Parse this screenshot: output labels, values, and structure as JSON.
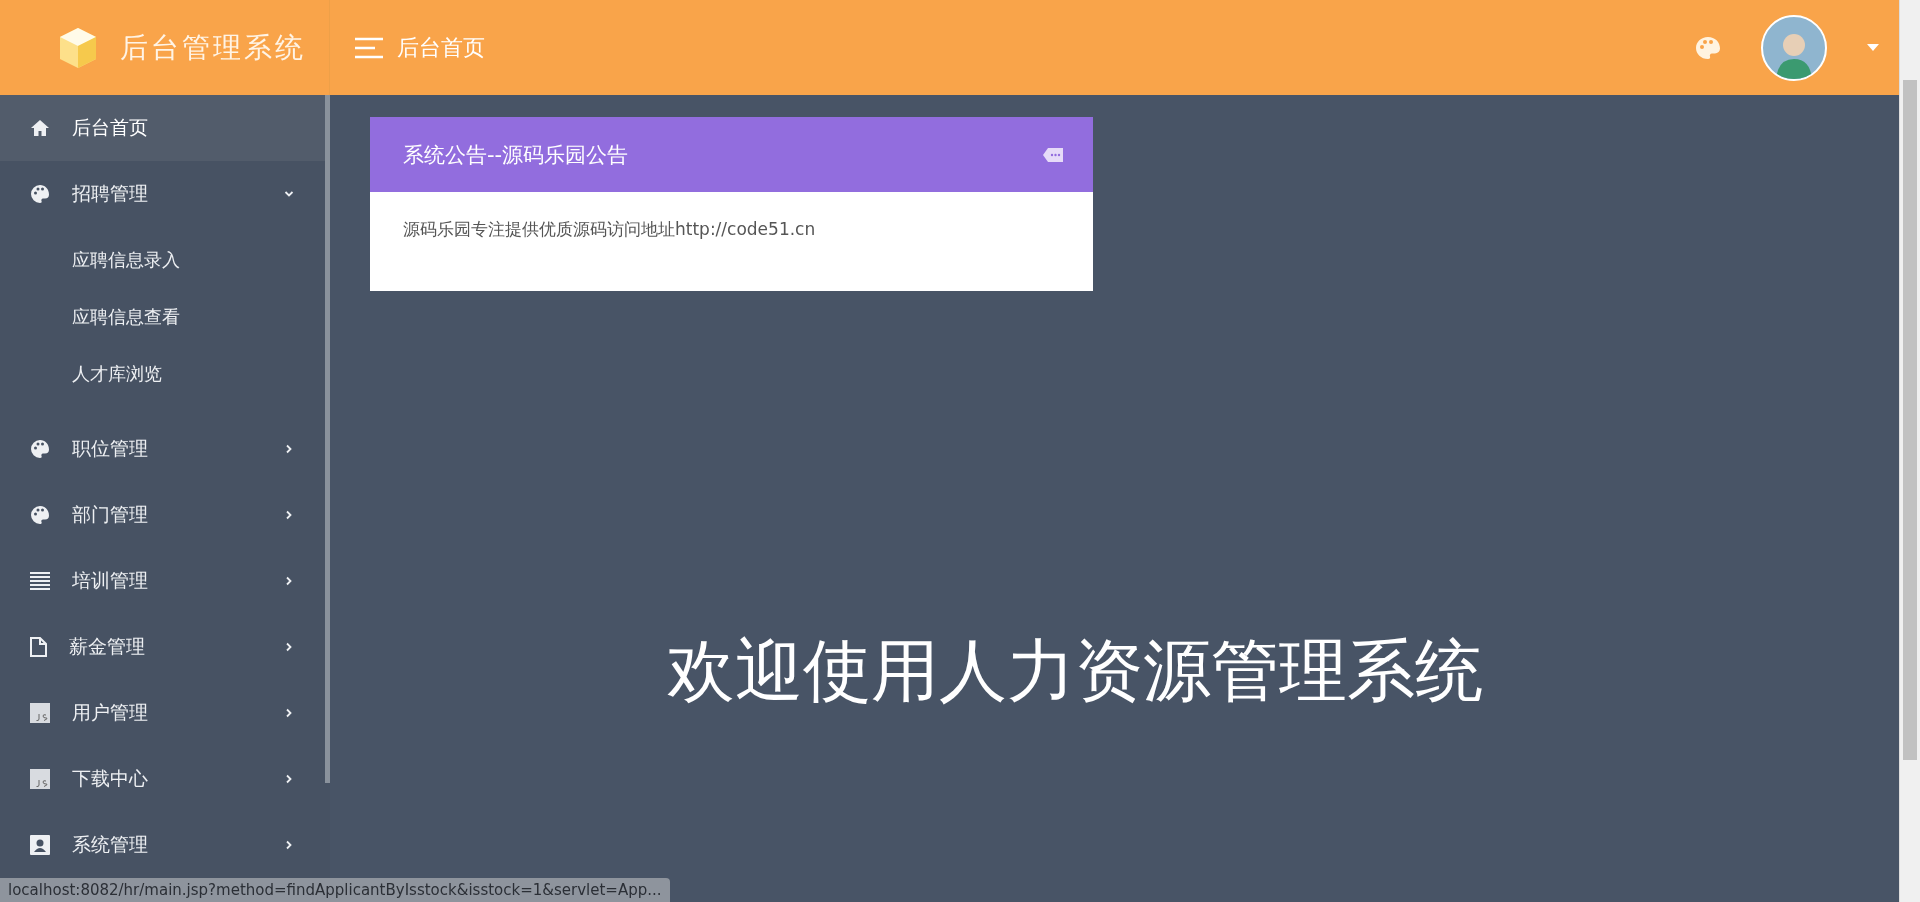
{
  "header": {
    "brand": "后台管理系统",
    "breadcrumb": "后台首页"
  },
  "sidebar": {
    "items": [
      {
        "kind": "home",
        "label": "后台首页",
        "selected": true
      },
      {
        "kind": "palette",
        "label": "招聘管理",
        "selected": false,
        "expanded": true,
        "children": [
          {
            "label": "应聘信息录入"
          },
          {
            "label": "应聘信息查看"
          },
          {
            "label": "人才库浏览"
          }
        ]
      },
      {
        "kind": "palette",
        "label": "职位管理",
        "selected": false,
        "expanded": false
      },
      {
        "kind": "palette",
        "label": "部门管理",
        "selected": false,
        "expanded": false
      },
      {
        "kind": "list",
        "label": "培训管理",
        "selected": false,
        "expanded": false
      },
      {
        "kind": "file",
        "label": "薪金管理",
        "selected": false,
        "expanded": false
      },
      {
        "kind": "js",
        "label": "用户管理",
        "selected": false,
        "expanded": false
      },
      {
        "kind": "js",
        "label": "下载中心",
        "selected": false,
        "expanded": false
      },
      {
        "kind": "user",
        "label": "系统管理",
        "selected": false,
        "expanded": false
      }
    ]
  },
  "notice": {
    "title": "系统公告--源码乐园公告",
    "body": "源码乐园专注提供优质源码访问地址http://code51.cn"
  },
  "welcome": "欢迎使用人力资源管理系统",
  "status_bar": {
    "url": "localhost:8082/hr/main.jsp?method=findApplicantByIsstock&isstock=1&servlet=App..."
  }
}
